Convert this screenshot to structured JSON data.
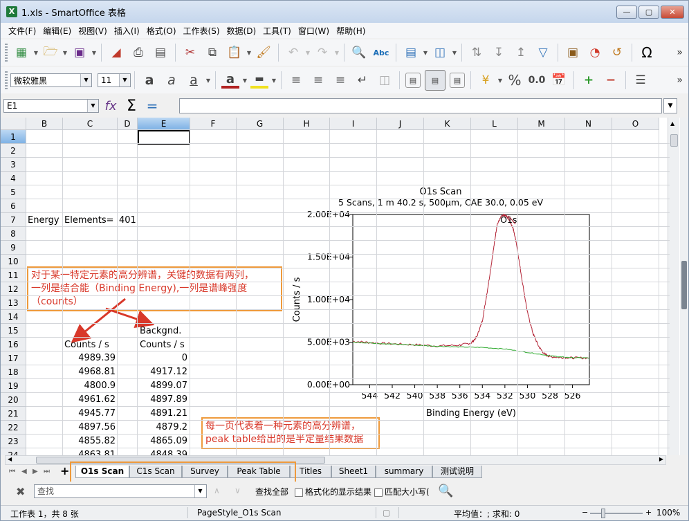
{
  "window": {
    "title": "1.xls - SmartOffice 表格",
    "app_icon": "X"
  },
  "menu": [
    "文件(F)",
    "编辑(E)",
    "视图(V)",
    "插入(I)",
    "格式(O)",
    "工作表(S)",
    "数据(D)",
    "工具(T)",
    "窗口(W)",
    "帮助(H)"
  ],
  "toolbar": {
    "font_name": "微软雅黑",
    "font_size": "11",
    "percent": "%",
    "decimal": "0.0",
    "omega": "Ω"
  },
  "formula_bar": {
    "name_box": "E1",
    "formula": ""
  },
  "columns": [
    "B",
    "C",
    "D",
    "E",
    "F",
    "G",
    "H",
    "I",
    "J",
    "K",
    "L",
    "M",
    "N",
    "O"
  ],
  "rows": [
    "1",
    "2",
    "3",
    "4",
    "5",
    "6",
    "7",
    "8",
    "9",
    "10",
    "11",
    "12",
    "13",
    "14",
    "15",
    "16",
    "17",
    "18",
    "19",
    "20",
    "21",
    "22",
    "23",
    "24"
  ],
  "cells": {
    "b7": "Energy",
    "c7": "Elements=",
    "d7": "401",
    "e15": "Backgnd.",
    "c16": "Counts / s",
    "e16": "Counts / s",
    "c_values": [
      "4989.39",
      "4968.81",
      "4800.9",
      "4961.62",
      "4945.77",
      "4897.56",
      "4855.82",
      "4863.81"
    ],
    "e_values": [
      "0",
      "4917.12",
      "4899.07",
      "4897.89",
      "4891.21",
      "4879.2",
      "4865.09",
      "4848.39"
    ]
  },
  "annotations": {
    "top": [
      "对于某一特定元素的高分辨谱，关键的数据有两列，",
      "一列是结合能（Binding Energy),一列是谱峰强度",
      "（counts）"
    ],
    "bottom": [
      "每一页代表着一种元素的高分辨谱，",
      "peak table给出的是半定量结果数据"
    ],
    "color": "#d8382a",
    "border_color": "#ee9a3c"
  },
  "chart_data": {
    "type": "line",
    "title": "O1s Scan",
    "subtitle": "5 Scans,  1 m 40.2 s,  500µm,  CAE 30.0,  0.05 eV",
    "xlabel": "Binding Energy (eV)",
    "ylabel": "Counts / s",
    "xlim": [
      545.5,
      524.5
    ],
    "ylim": [
      0,
      20000
    ],
    "x_reversed": true,
    "x_ticks": [
      544,
      542,
      540,
      538,
      536,
      534,
      532,
      530,
      528,
      526
    ],
    "y_ticks": [
      0,
      5000,
      10000,
      15000,
      20000
    ],
    "y_tick_labels": [
      "0.00E+00",
      "5.00E+03",
      "1.00E+04",
      "1.50E+04",
      "2.00E+04"
    ],
    "peak_label": "O1s",
    "series": [
      {
        "color": "#b22234",
        "x": [
          545.5,
          544,
          542,
          540,
          538,
          536,
          535,
          534.5,
          534,
          533.5,
          533,
          532.7,
          532.3,
          532,
          531.7,
          531.3,
          531,
          530.5,
          530,
          529.5,
          529,
          528.5,
          528,
          527,
          526,
          524.5
        ],
        "y": [
          5100,
          4950,
          4800,
          4700,
          4550,
          4650,
          4900,
          5600,
          7500,
          11500,
          16000,
          18800,
          19800,
          19900,
          19600,
          18500,
          16800,
          12500,
          8500,
          6000,
          4500,
          3600,
          3300,
          3200,
          3150,
          3150
        ]
      },
      {
        "color": "#2eaa2e",
        "x": [
          545.5,
          544,
          542,
          540,
          538,
          536,
          534,
          532,
          530,
          528,
          527,
          526,
          524.5
        ],
        "y": [
          5000,
          4900,
          4780,
          4650,
          4520,
          4430,
          4380,
          4200,
          3800,
          3400,
          3250,
          3170,
          3150
        ]
      }
    ]
  },
  "sheet_tabs": [
    "O1s Scan",
    "C1s Scan",
    "Survey",
    "Peak Table",
    "Titles",
    "Sheet1",
    "summary",
    "测试说明"
  ],
  "active_tab": "O1s Scan",
  "find_bar": {
    "placeholder": "查找",
    "find_all": "查找全部",
    "formatted": "格式化的显示结果",
    "match_case": "匹配大小写("
  },
  "status": {
    "sheet_info": "工作表 1，共 8 张",
    "page_style": "PageStyle_O1s Scan",
    "summary": "平均值：; 求和: 0",
    "zoom": "100%"
  }
}
